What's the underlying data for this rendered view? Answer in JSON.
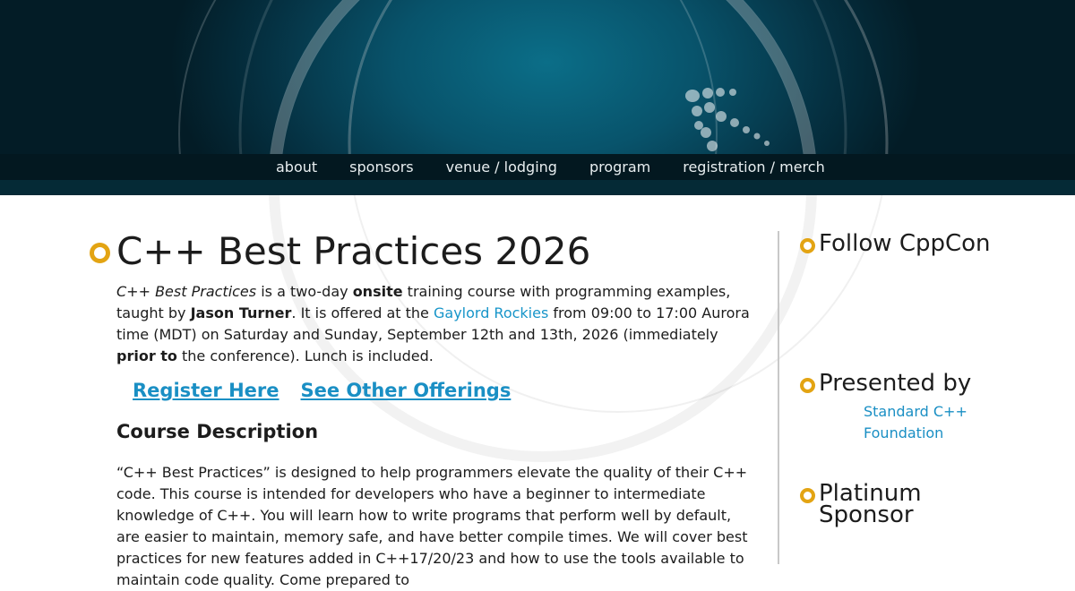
{
  "nav": {
    "items": [
      "about",
      "sponsors",
      "venue / lodging",
      "program",
      "registration / merch"
    ]
  },
  "main": {
    "title": "C++ Best Practices 2026",
    "intro": {
      "course_name": "C++ Best Practices",
      "t1": " is a two-day ",
      "onsite": "onsite",
      "t2": " training course with programming examples, taught by ",
      "instructor": "Jason Turner",
      "t3": ". It is offered at the ",
      "venue_link": "Gaylord Rockies",
      "t4": " from 09:00 to 17:00 Aurora time (MDT) on Saturday and Sunday, September 12th and 13th, 2026 (immediately ",
      "prior_to": "prior to",
      "t5": " the conference). Lunch is included."
    },
    "register_label": "Register Here",
    "offerings_label": "See Other Offerings",
    "section_title": "Course Description",
    "description": "“C++ Best Practices” is designed to help programmers elevate the quality of their C++ code. This course is intended for developers who have a beginner to intermediate knowledge of C++. You will learn how to write programs that perform well by default, are easier to maintain, memory safe, and have better compile times. We will cover best practices for new features added in C++17/20/23 and how to use the tools available to maintain code quality. Come prepared to"
  },
  "sidebar": {
    "follow_title": "Follow CppCon",
    "presented_title": "Presented by",
    "presented_link": "Standard C++ Foundation",
    "platinum_title": "Platinum Sponsor"
  },
  "colors": {
    "accent_bullet": "#e3a413",
    "link": "#1a8fc4",
    "banner": "#08536b"
  }
}
